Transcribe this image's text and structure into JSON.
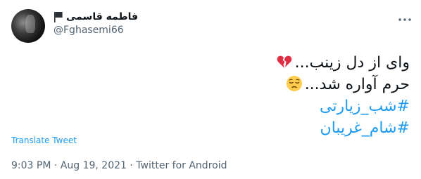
{
  "author": {
    "display_name": "فاطمه قاسمی",
    "handle": "@Fghasemi66",
    "flag_icon": "black-flag-icon"
  },
  "tweet": {
    "line1_text": "وای از دل زینب...",
    "line1_emoji": "broken-heart-icon",
    "line2_text": "حرم آواره شد...",
    "line2_emoji": "pensive-face-icon",
    "hashtags": [
      "#شب_زیارتی",
      "#شام_غریبان"
    ]
  },
  "translate_label": "Translate Tweet",
  "meta": {
    "time": "9:03 PM",
    "separator": " · ",
    "date": "Aug 19, 2021",
    "source": "Twitter for Android"
  },
  "colors": {
    "link": "#1d9bf0",
    "muted": "#536471",
    "text": "#0f1419"
  }
}
